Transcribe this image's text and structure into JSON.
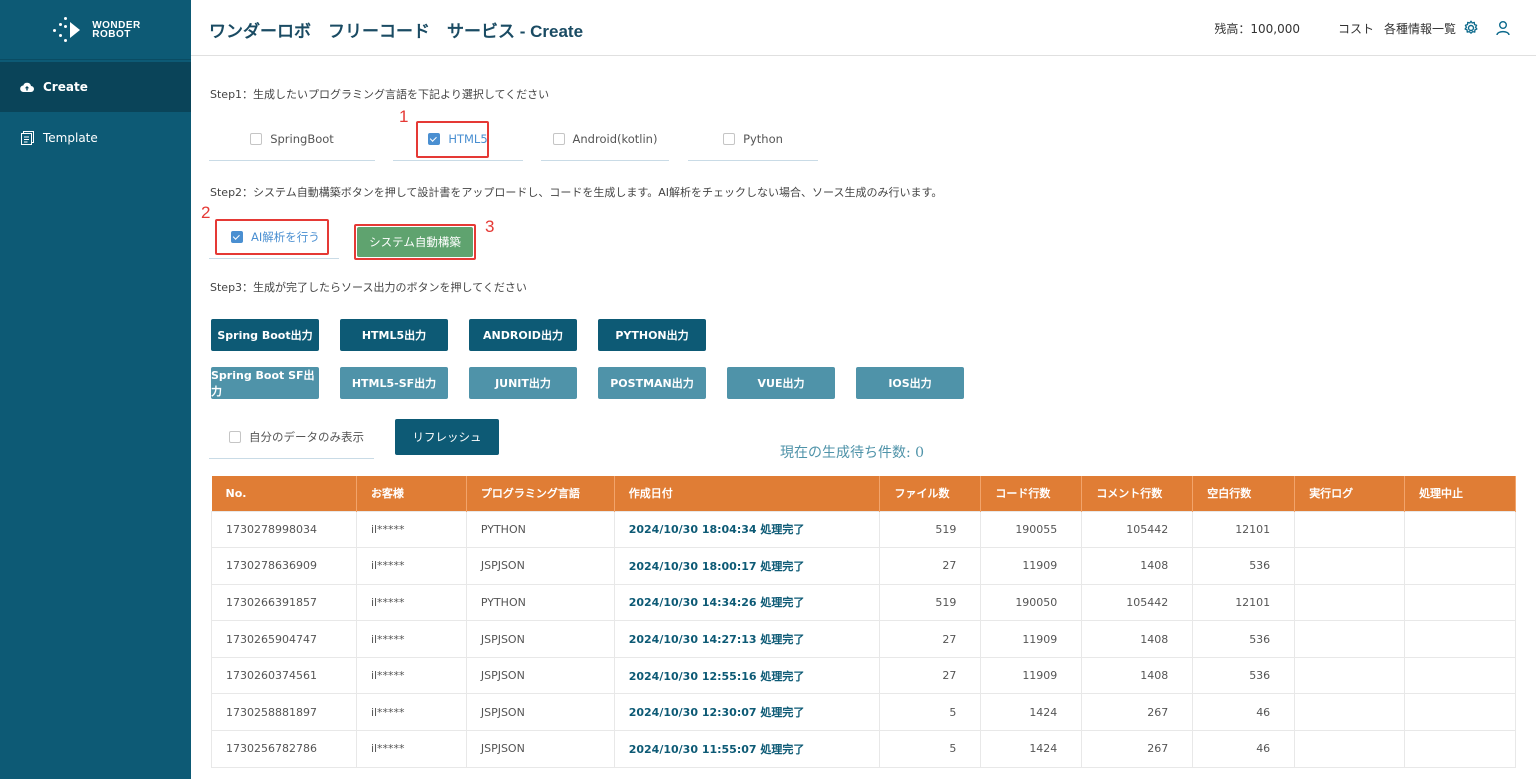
{
  "app": {
    "logo_line1": "WONDER",
    "logo_line2": "ROBOT",
    "title": "ワンダーロボ　フリーコード　サービス - Create"
  },
  "sidebar": {
    "items": [
      {
        "label": "Create",
        "icon": "cloud-upload-icon",
        "active": true
      },
      {
        "label": "Template",
        "icon": "template-icon",
        "active": false
      }
    ]
  },
  "header": {
    "balance": "残高：100,000",
    "cost": "コスト",
    "info_list": "各種情報一覧"
  },
  "step1": {
    "label": "Step1：生成したいプログラミング言語を下記より選択してください",
    "options": [
      {
        "label": "SpringBoot",
        "checked": false
      },
      {
        "label": "HTML5",
        "checked": true
      },
      {
        "label": "Android(kotlin)",
        "checked": false
      },
      {
        "label": "Python",
        "checked": false
      }
    ]
  },
  "step2": {
    "label": "Step2：システム自動構築ボタンを押して設計書をアップロードし、コードを生成します。AI解析をチェックしない場合、ソース生成のみ行います。",
    "ai_checkbox_label": "AI解析を行う",
    "ai_checked": true,
    "build_button": "システム自動構築"
  },
  "step3": {
    "label": "Step3：生成が完了したらソース出力のボタンを押してください",
    "primary_buttons": [
      "Spring Boot出力",
      "HTML5出力",
      "ANDROID出力",
      "PYTHON出力"
    ],
    "secondary_buttons": [
      "Spring Boot SF出力",
      "HTML5-SF出力",
      "JUNIT出力",
      "POSTMAN出力",
      "VUE出力",
      "IOS出力"
    ]
  },
  "filter": {
    "own_data_label": "自分のデータのみ表示",
    "refresh": "リフレッシュ",
    "pending": "現在の生成待ち件数: 0"
  },
  "annotations": [
    "1",
    "2",
    "3"
  ],
  "colors": {
    "sidebar": "#0d5a75",
    "table_header": "#e07d35",
    "primary_button": "#0d5a75",
    "secondary_button": "#4f93a9",
    "build_button": "#5fa36f",
    "annotation": "#e53935"
  },
  "table": {
    "columns": [
      "No.",
      "お客様",
      "プログラミング言語",
      "作成日付",
      "ファイル数",
      "コード行数",
      "コメント行数",
      "空白行数",
      "実行ログ",
      "処理中止"
    ],
    "rows": [
      {
        "no": "1730278998034",
        "customer": "il*****",
        "lang": "PYTHON",
        "date": "2024/10/30 18:04:34 処理完了",
        "files": "519",
        "code": "190055",
        "comment": "105442",
        "blank": "12101"
      },
      {
        "no": "1730278636909",
        "customer": "il*****",
        "lang": "JSPJSON",
        "date": "2024/10/30 18:00:17 処理完了",
        "files": "27",
        "code": "11909",
        "comment": "1408",
        "blank": "536"
      },
      {
        "no": "1730266391857",
        "customer": "il*****",
        "lang": "PYTHON",
        "date": "2024/10/30 14:34:26 処理完了",
        "files": "519",
        "code": "190050",
        "comment": "105442",
        "blank": "12101"
      },
      {
        "no": "1730265904747",
        "customer": "il*****",
        "lang": "JSPJSON",
        "date": "2024/10/30 14:27:13 処理完了",
        "files": "27",
        "code": "11909",
        "comment": "1408",
        "blank": "536"
      },
      {
        "no": "1730260374561",
        "customer": "il*****",
        "lang": "JSPJSON",
        "date": "2024/10/30 12:55:16 処理完了",
        "files": "27",
        "code": "11909",
        "comment": "1408",
        "blank": "536"
      },
      {
        "no": "1730258881897",
        "customer": "il*****",
        "lang": "JSPJSON",
        "date": "2024/10/30 12:30:07 処理完了",
        "files": "5",
        "code": "1424",
        "comment": "267",
        "blank": "46"
      },
      {
        "no": "1730256782786",
        "customer": "il*****",
        "lang": "JSPJSON",
        "date": "2024/10/30 11:55:07 処理完了",
        "files": "5",
        "code": "1424",
        "comment": "267",
        "blank": "46"
      }
    ]
  }
}
